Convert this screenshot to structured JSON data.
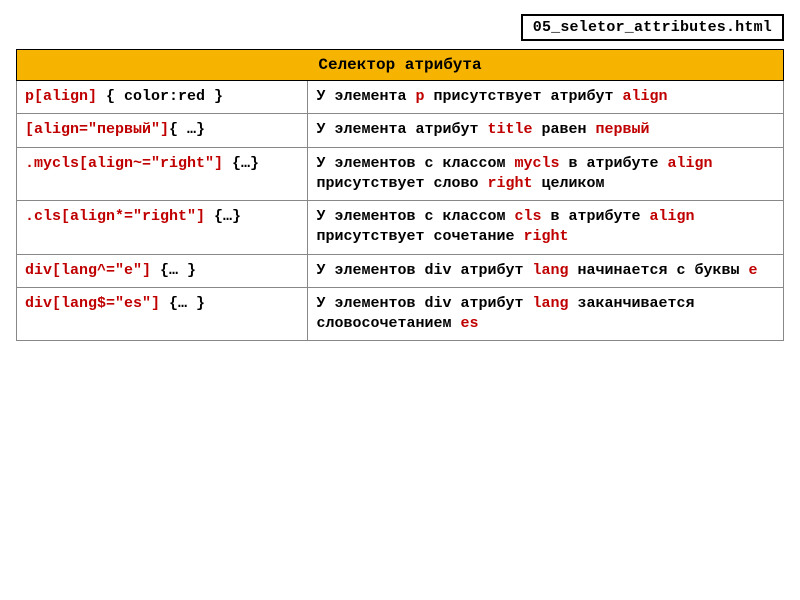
{
  "filename": "05_seletor_attributes.html",
  "table": {
    "title": "Селектор атрибута",
    "rows": [
      {
        "selector": [
          {
            "t": "p[align]",
            "red": true
          },
          {
            "t": " { color:red }",
            "red": false
          }
        ],
        "desc": [
          {
            "t": "У элемента ",
            "red": false
          },
          {
            "t": "p",
            "red": true
          },
          {
            "t": " присутствует атрибут ",
            "red": false
          },
          {
            "t": "align",
            "red": true
          }
        ]
      },
      {
        "selector": [
          {
            "t": "[align=\"первый\"]",
            "red": true
          },
          {
            "t": "{ …}",
            "red": false
          }
        ],
        "desc": [
          {
            "t": "У элемента атрибут ",
            "red": false
          },
          {
            "t": "title",
            "red": true
          },
          {
            "t": " равен ",
            "red": false
          },
          {
            "t": "первый",
            "red": true
          }
        ]
      },
      {
        "selector": [
          {
            "t": ".mycls[align~=\"right\"]",
            "red": true
          },
          {
            "t": " {…}",
            "red": false
          }
        ],
        "desc": [
          {
            "t": "У элементов с классом ",
            "red": false
          },
          {
            "t": "mycls",
            "red": true
          },
          {
            "t": " в атрибуте ",
            "red": false
          },
          {
            "t": "align",
            "red": true
          },
          {
            "t": " присутствует слово ",
            "red": false
          },
          {
            "t": "right",
            "red": true
          },
          {
            "t": "  целиком",
            "red": false
          }
        ]
      },
      {
        "selector": [
          {
            "t": ".cls[align*=\"right\"]",
            "red": true
          },
          {
            "t": " {…}",
            "red": false
          }
        ],
        "desc": [
          {
            "t": "У элементов с классом ",
            "red": false
          },
          {
            "t": "cls",
            "red": true
          },
          {
            "t": " в атрибуте ",
            "red": false
          },
          {
            "t": "align",
            "red": true
          },
          {
            "t": " присутствует сочетание ",
            "red": false
          },
          {
            "t": "right",
            "red": true
          }
        ]
      },
      {
        "selector": [
          {
            "t": "div[lang^=\"e\"]",
            "red": true
          },
          {
            "t": " {… }",
            "red": false
          }
        ],
        "desc": [
          {
            "t": "У элементов div атрибут ",
            "red": false
          },
          {
            "t": "lang",
            "red": true
          },
          {
            "t": " начинается с буквы ",
            "red": false
          },
          {
            "t": "e",
            "red": true
          }
        ]
      },
      {
        "selector": [
          {
            "t": "div[lang$=\"es\"]",
            "red": true
          },
          {
            "t": " {… }",
            "red": false
          }
        ],
        "desc": [
          {
            "t": "У элементов div атрибут ",
            "red": false
          },
          {
            "t": "lang",
            "red": true
          },
          {
            "t": " заканчивается словосочетанием ",
            "red": false
          },
          {
            "t": "es",
            "red": true
          }
        ]
      }
    ]
  }
}
